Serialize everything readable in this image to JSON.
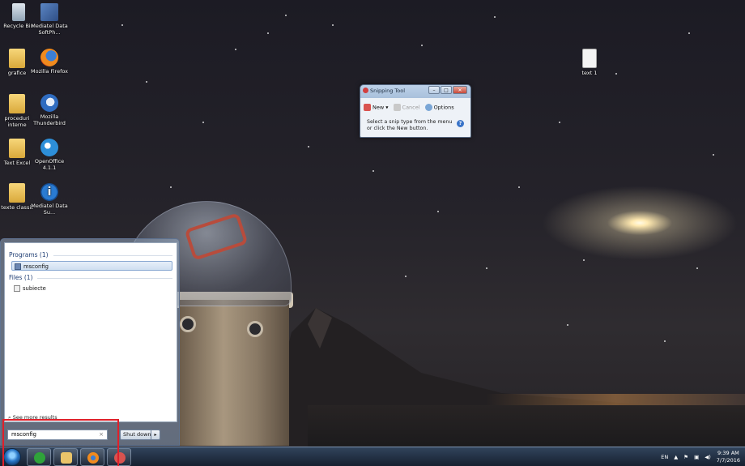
{
  "desktop": {
    "icons": [
      {
        "label": "Recycle Bin",
        "icon": "recycle-bin-icon"
      },
      {
        "label": "Mediatel Data SoftPh...",
        "icon": "mediatel-softphone-icon"
      },
      {
        "label": "grafice",
        "icon": "folder-icon"
      },
      {
        "label": "Mozilla Firefox",
        "icon": "firefox-icon"
      },
      {
        "label": "proceduri interne",
        "icon": "folder-icon"
      },
      {
        "label": "Mozilla Thunderbird",
        "icon": "thunderbird-icon"
      },
      {
        "label": "Text Excel",
        "icon": "folder-icon"
      },
      {
        "label": "OpenOffice 4.1.1",
        "icon": "openoffice-icon"
      },
      {
        "label": "texte classit",
        "icon": "folder-icon"
      },
      {
        "label": "Mediatel Data Su...",
        "icon": "mediatel-info-icon"
      },
      {
        "label": "text 1",
        "icon": "text-document-icon"
      }
    ]
  },
  "snipping_tool": {
    "title": "Snipping Tool",
    "new_label": "New",
    "cancel_label": "Cancel",
    "options_label": "Options",
    "message": "Select a snip type from the menu or click the New button.",
    "help_glyph": "?",
    "controls": {
      "minimize": "–",
      "maximize": "□",
      "close": "✕"
    }
  },
  "start_menu": {
    "programs_heading": "Programs (1)",
    "programs": [
      {
        "label": "msconfig"
      }
    ],
    "files_heading": "Files (1)",
    "files": [
      {
        "label": "subiecte"
      }
    ],
    "see_more": "See more results",
    "search_value": "msconfig",
    "search_clear": "×",
    "shutdown_label": "Shut down",
    "shutdown_arrow": "▸"
  },
  "taskbar": {
    "tray": {
      "language": "EN",
      "time": "9:39 AM",
      "date": "7/7/2016"
    }
  },
  "colors": {
    "highlight": "#e0202a",
    "accent": "#2b78c8"
  }
}
